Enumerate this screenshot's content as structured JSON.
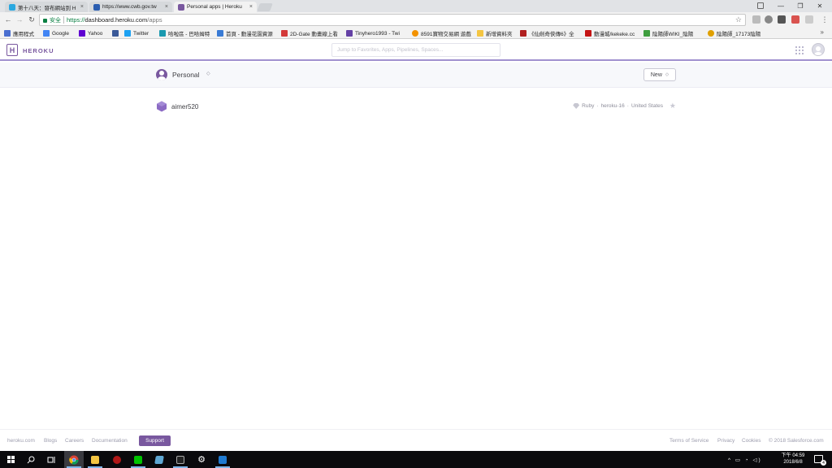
{
  "browser": {
    "tabs": [
      {
        "title": "第十八天：發布網站到 H",
        "favicon_color": "#2aa8e0"
      },
      {
        "title": "https://www.cwb.gov.tw",
        "favicon_color": "#2a5db0"
      },
      {
        "title": "Personal apps | Heroku",
        "favicon_color": "#79589f"
      }
    ],
    "close_glyph": "×",
    "nav": {
      "back": "←",
      "forward": "→",
      "reload": "↻"
    },
    "address_bar": {
      "secure_label": "安全",
      "url_protocol": "https://",
      "url_host": "dashboard.heroku.com",
      "url_path": "/apps",
      "bookmark_star": "☆"
    },
    "window_controls": {
      "minimize": "—",
      "maximize": "❐",
      "close": "✕"
    },
    "menu_glyph": "⋮",
    "bookmarks": [
      {
        "label": "應用程式",
        "color": "#4a6fd0"
      },
      {
        "label": "Google",
        "color": "#4285f4"
      },
      {
        "label": "Yahoo",
        "color": "#5f01d1"
      },
      {
        "label": "",
        "color": "#3b5998"
      },
      {
        "label": "Twitter",
        "color": "#1da1f2"
      },
      {
        "label": "哈啦區 - 巴哈姆特",
        "color": "#1b9ab0"
      },
      {
        "label": "首頁 - 動漫花園資源",
        "color": "#3a7bd5"
      },
      {
        "label": "2D-Gate 動畫線上看",
        "color": "#d33a3a"
      },
      {
        "label": "Tinyhero1993 - Twi",
        "color": "#6441a5"
      },
      {
        "label": "8591寶物交易網 遊戲",
        "color": "#f39200"
      },
      {
        "label": "新增資料夾",
        "color": "#f4c542"
      },
      {
        "label": "《仙劍奇俠傳6》全",
        "color": "#b02020"
      },
      {
        "label": "動漫城/kekeke.cc",
        "color": "#c41414"
      },
      {
        "label": "陰陽師WIKI_陰陽",
        "color": "#3f9e3f"
      },
      {
        "label": "陰陽師_17173陰陽",
        "color": "#e0a000"
      }
    ],
    "bookmarks_more": "»"
  },
  "heroku": {
    "logo_letter": "H",
    "logo_text": "HEROKU",
    "search_placeholder": "Jump to Favorites, Apps, Pipelines, Spaces...",
    "account": {
      "name": "Personal",
      "caret": "◇"
    },
    "new_button": {
      "label": "New",
      "caret": "◇"
    },
    "apps": [
      {
        "name": "aimer520",
        "language": "Ruby",
        "stack": "heroku-16",
        "region": "United States",
        "separator": "·",
        "favorite_glyph": "★"
      }
    ],
    "footer": {
      "links_left": [
        "heroku.com",
        "Blogs",
        "Careers",
        "Documentation"
      ],
      "support_label": "Support",
      "links_right": [
        "Terms of Service",
        "Privacy",
        "Cookies",
        "© 2018 Salesforce.com"
      ]
    },
    "accent_color": "#79589f"
  },
  "taskbar": {
    "clock_time": "下午 04:59",
    "clock_date": "2018/6/8",
    "notification_count": "4",
    "tray_glyphs": "^ ▭ ◔ ◁)"
  }
}
